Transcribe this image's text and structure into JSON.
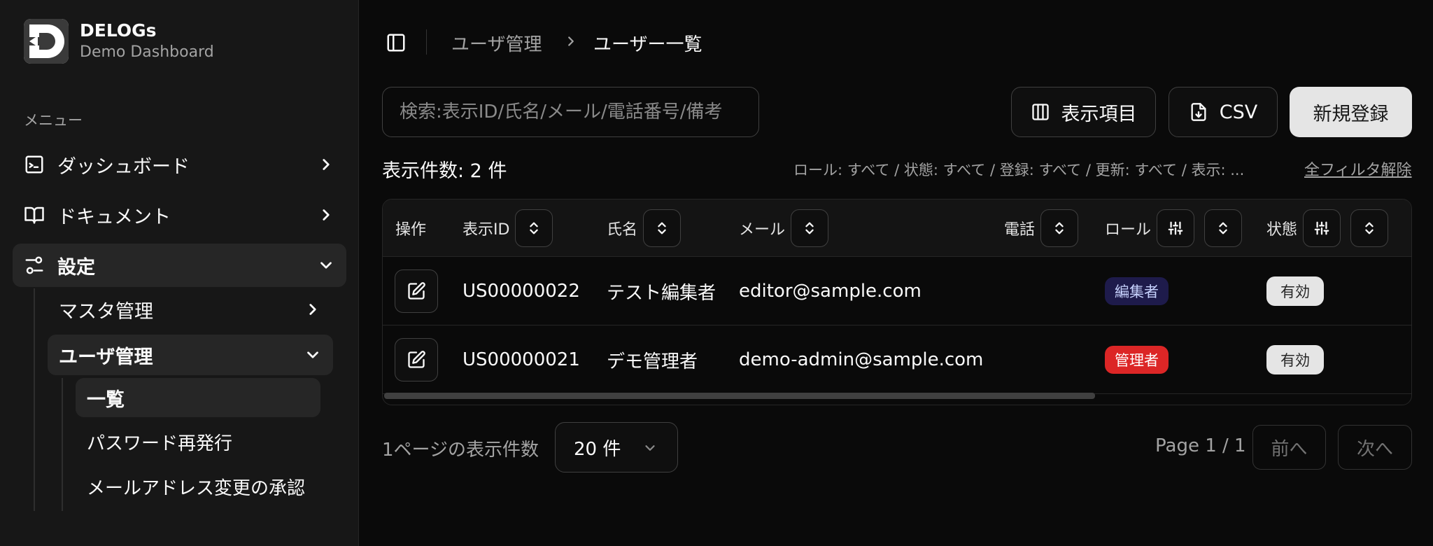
{
  "app": {
    "name": "DELOGs",
    "subtitle": "Demo Dashboard"
  },
  "sidebar": {
    "heading": "メニュー",
    "items": [
      {
        "label": "ダッシュボード"
      },
      {
        "label": "ドキュメント"
      },
      {
        "label": "設定"
      }
    ],
    "settings_children": [
      {
        "label": "マスタ管理"
      },
      {
        "label": "ユーザ管理"
      }
    ],
    "user_children": [
      {
        "label": "一覧"
      },
      {
        "label": "パスワード再発行"
      },
      {
        "label": "メールアドレス変更の承認"
      }
    ]
  },
  "breadcrumb": {
    "parent": "ユーザ管理",
    "current": "ユーザー一覧"
  },
  "toolbar": {
    "search_placeholder": "検索:表示ID/氏名/メール/電話番号/備考",
    "columns_label": "表示項目",
    "csv_label": "CSV",
    "new_label": "新規登録"
  },
  "summary": {
    "count_text": "表示件数: 2 件",
    "filters_text": "ロール: すべて / 状態: すべて / 登録: すべて / 更新: すべて / 表示: ...",
    "clear_filters": "全フィルタ解除"
  },
  "table": {
    "headers": {
      "actions": "操作",
      "display_id": "表示ID",
      "name": "氏名",
      "email": "メール",
      "phone": "電話",
      "role": "ロール",
      "status": "状態"
    },
    "rows": [
      {
        "display_id": "US00000022",
        "name": "テスト編集者",
        "email": "editor@sample.com",
        "phone": "",
        "role": "編集者",
        "status": "有効"
      },
      {
        "display_id": "US00000021",
        "name": "デモ管理者",
        "email": "demo-admin@sample.com",
        "phone": "",
        "role": "管理者",
        "status": "有効"
      }
    ]
  },
  "pagination": {
    "per_page_label": "1ページの表示件数",
    "per_page_value": "20 件",
    "page_info": "Page 1 / 1",
    "prev": "前へ",
    "next": "次へ"
  },
  "colors": {
    "accent_primary": "#e5e5e5",
    "badge_admin": "#dc2626",
    "badge_editor": "#1e1b4b"
  }
}
